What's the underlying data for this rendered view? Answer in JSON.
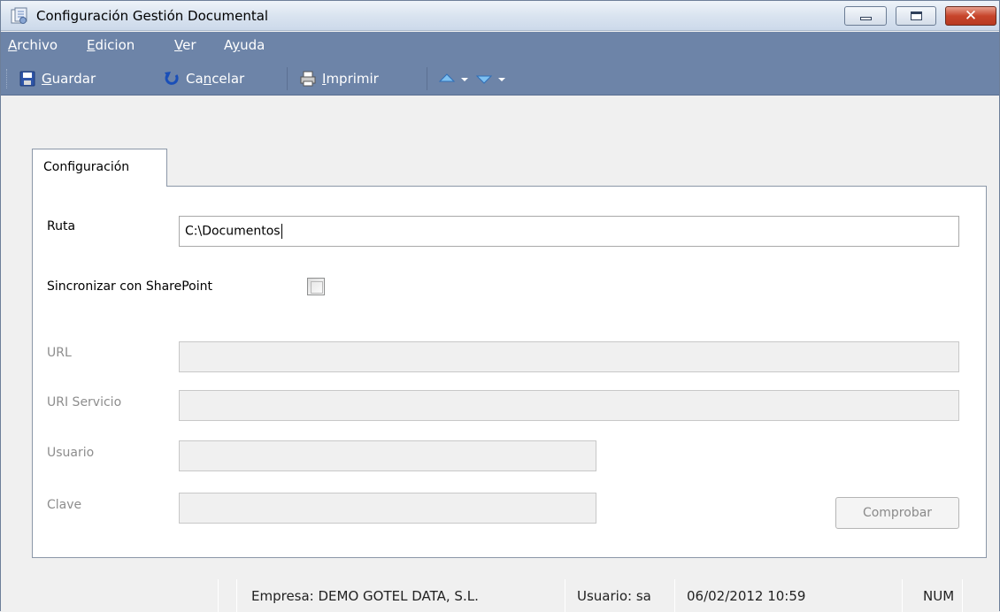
{
  "window": {
    "title": "Configuración Gestión Documental",
    "close_glyph": "✕"
  },
  "menu": {
    "items": [
      {
        "label": "Archivo",
        "mnemonic": "A",
        "rest": "rchivo"
      },
      {
        "label": "Edicion",
        "mnemonic": "E",
        "rest": "dicion"
      },
      {
        "label": "Ver",
        "mnemonic": "V",
        "rest": "er"
      },
      {
        "label": "Ayuda",
        "pre": "A",
        "mnemonic": "y",
        "rest": "uda"
      }
    ]
  },
  "toolbar": {
    "save_mn": "G",
    "save_rest": "uardar",
    "cancel_pre": "Ca",
    "cancel_mn": "n",
    "cancel_rest": "celar",
    "print_mn": "I",
    "print_rest": "mprimir",
    "icons": [
      "save-icon",
      "undo-icon",
      "printer-icon",
      "arrow-up-icon",
      "dropdown-arrow-icon",
      "arrow-down-icon",
      "dropdown-arrow-icon"
    ]
  },
  "tabs": [
    {
      "label": "Configuración",
      "active": true
    }
  ],
  "form": {
    "ruta_label": "Ruta",
    "ruta_value": "C:\\Documentos",
    "sync_label": "Sincronizar con SharePoint",
    "sync_checked": false,
    "url_label": "URL",
    "url_value": "",
    "uri_label": "URI Servicio",
    "uri_value": "",
    "usuario_label": "Usuario",
    "usuario_value": "",
    "clave_label": "Clave",
    "clave_value": "",
    "check_button": "Comprobar"
  },
  "status": {
    "empresa": "Empresa: DEMO GOTEL DATA, S.L.",
    "usuario": "Usuario: sa",
    "datetime": "06/02/2012 10:59",
    "num": "NUM"
  },
  "colors": {
    "menubar": "#6d84a8",
    "titlebar": "#dae4f0",
    "close_button": "#c7452b"
  }
}
